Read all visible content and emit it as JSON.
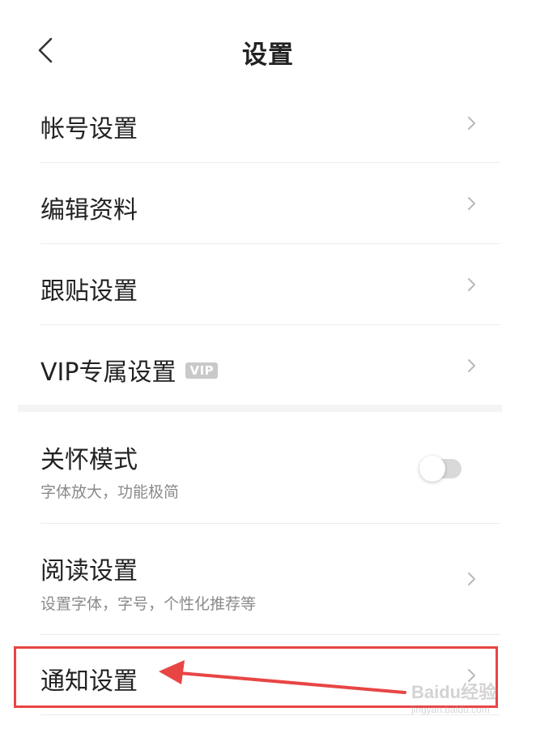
{
  "header": {
    "title": "设置",
    "back_icon": "chevron-left-icon"
  },
  "settings": {
    "account": {
      "label": "帐号设置"
    },
    "edit_profile": {
      "label": "编辑资料"
    },
    "follow_post": {
      "label": "跟贴设置"
    },
    "vip": {
      "label": "VIP专属设置",
      "badge": "VIP"
    },
    "care_mode": {
      "label": "关怀模式",
      "subtitle": "字体放大，功能极简",
      "enabled": false
    },
    "reading": {
      "label": "阅读设置",
      "subtitle": "设置字体，字号，个性化推荐等"
    },
    "notification": {
      "label": "通知设置"
    }
  },
  "annotation": {
    "color": "#e84545",
    "target": "notification"
  },
  "watermark": {
    "text": "Baidu经验",
    "sub": "jingyan.baidu.com"
  }
}
